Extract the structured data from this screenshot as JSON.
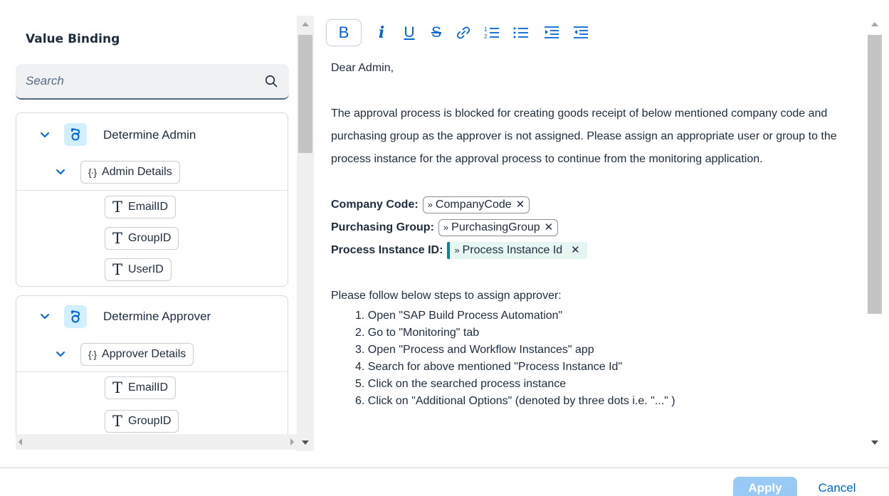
{
  "value_binding": {
    "title": "Value Binding",
    "search_placeholder": "Search",
    "groups": [
      {
        "step_label": "Determine Admin",
        "object_label": "Admin Details",
        "fields": [
          "EmailID",
          "GroupID",
          "UserID"
        ]
      },
      {
        "step_label": "Determine Approver",
        "object_label": "Approver Details",
        "fields": [
          "EmailID",
          "GroupID"
        ]
      }
    ]
  },
  "toolbar": {
    "bold": "B",
    "italic": "i",
    "underline": "U",
    "strikethrough": "S"
  },
  "document": {
    "greeting": "Dear Admin,",
    "paragraph": "The approval process is blocked for creating goods receipt of below mentioned company code and purchasing group as the approver is not assigned. Please assign an appropriate user or group to the process instance for the approval process to continue from the monitoring application.",
    "fields": [
      {
        "label": "Company Code:",
        "token": "CompanyCode"
      },
      {
        "label": "Purchasing Group:",
        "token": "PurchasingGroup"
      },
      {
        "label": "Process Instance ID:",
        "token": "Process Instance Id"
      }
    ],
    "steps_title": "Please follow below steps to assign approver:",
    "steps": [
      "1. Open \"SAP Build Process Automation\"",
      "2. Go to \"Monitoring\" tab",
      "3. Open \"Process and Workflow Instances\" app",
      "4. Search for above mentioned \"Process Instance Id\"",
      "5. Click on the searched process instance",
      "6. Click on \"Additional Options\" (denoted by three dots i.e. \"...\" )"
    ]
  },
  "footer": {
    "apply_label": "Apply",
    "cancel_label": "Cancel"
  },
  "colors": {
    "accent": "#0064d9",
    "apply_disabled": "#99c9f5",
    "highlight_token": "#e6f6f2",
    "highlight_bar": "#0f828f"
  }
}
